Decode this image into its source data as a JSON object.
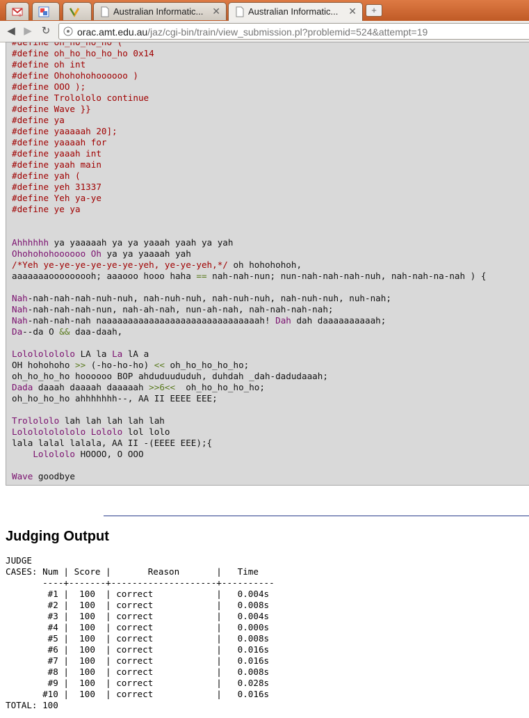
{
  "browser": {
    "tabs": [
      {
        "label": "",
        "icon": "gmail-icon"
      },
      {
        "label": "",
        "icon": "reader-icon"
      },
      {
        "label": "",
        "icon": "colorful-m-icon"
      },
      {
        "label": "Australian Informatic...",
        "icon": "page-icon"
      },
      {
        "label": "Australian Informatic...",
        "icon": "page-icon",
        "active": true
      }
    ],
    "gmail_count": "0",
    "url_host": "orac.amt.edu.au",
    "url_rest": "/jaz/cgi-bin/train/view_submission.pl?problemid=524&attempt=19"
  },
  "code_lines": [
    [
      [
        "pp",
        "#define oh_ho_ho_ho ( "
      ]
    ],
    [
      [
        "pp",
        "#define oh_ho_ho_ho_ho 0x14"
      ]
    ],
    [
      [
        "pp",
        "#define oh int"
      ]
    ],
    [
      [
        "pp",
        "#define Ohohohohoooooo )"
      ]
    ],
    [
      [
        "pp",
        "#define OOO );"
      ]
    ],
    [
      [
        "pp",
        "#define Trolololo continue"
      ]
    ],
    [
      [
        "pp",
        "#define Wave }}"
      ]
    ],
    [
      [
        "pp",
        "#define ya"
      ]
    ],
    [
      [
        "pp",
        "#define yaaaaah 20];"
      ]
    ],
    [
      [
        "pp",
        "#define yaaaah for"
      ]
    ],
    [
      [
        "pp",
        "#define yaaah int"
      ]
    ],
    [
      [
        "pp",
        "#define yaah main"
      ]
    ],
    [
      [
        "pp",
        "#define yah ("
      ]
    ],
    [
      [
        "pp",
        "#define yeh 31337"
      ]
    ],
    [
      [
        "pp",
        "#define Yeh ya-ye"
      ]
    ],
    [
      [
        "pp",
        "#define ye ya"
      ]
    ],
    [],
    [],
    [
      [
        "id",
        "Ahhhhhh"
      ],
      [
        "t",
        " ya yaaaaah ya ya yaaah yaah ya yah"
      ]
    ],
    [
      [
        "id",
        "Ohohohohoooooo"
      ],
      [
        "t",
        " "
      ],
      [
        "id",
        "Oh"
      ],
      [
        "t",
        " ya ya yaaaah yah"
      ]
    ],
    [
      [
        "cm",
        "/*Yeh ye-ye-ye-ye-ye-ye-yeh, ye-ye-yeh,*/"
      ],
      [
        "t",
        " oh hohohohoh,"
      ]
    ],
    [
      [
        "t",
        "aaaaaaaooooooooh; aaaooo hooo haha "
      ],
      [
        "op",
        "=="
      ],
      [
        "t",
        " nah-nah-nun; nun-nah-nah-nah-nuh, nah-nah-na-nah ) {"
      ]
    ],
    [],
    [
      [
        "id",
        "Nah"
      ],
      [
        "t",
        "-nah-nah-nah-nuh-nuh, nah-nuh-nuh, nah-nuh-nuh, nah-nuh-nuh, nuh-nah;"
      ]
    ],
    [
      [
        "id",
        "Nah"
      ],
      [
        "t",
        "-nah-nah-nah-nun, nah-ah-nah, nun-ah-nah, nah-nah-nah-nah;"
      ]
    ],
    [
      [
        "id",
        "Nah"
      ],
      [
        "t",
        "-nah-nah-nah naaaaaaaaaaaaaaaaaaaaaaaaaaaaaah! "
      ],
      [
        "id",
        "Dah"
      ],
      [
        "t",
        " dah daaaaaaaaaah;"
      ]
    ],
    [
      [
        "id",
        "Da"
      ],
      [
        "t",
        "--da O "
      ],
      [
        "op",
        "&&"
      ],
      [
        "t",
        " daa-daah,"
      ]
    ],
    [],
    [
      [
        "id",
        "Lolololololo"
      ],
      [
        "t",
        " LA la "
      ],
      [
        "id",
        "La"
      ],
      [
        "t",
        " lA a"
      ]
    ],
    [
      [
        "t",
        "OH hohohoho "
      ],
      [
        "op",
        ">>"
      ],
      [
        "t",
        " (-ho-ho-ho) "
      ],
      [
        "op",
        "<<"
      ],
      [
        "t",
        " oh_ho_ho_ho_ho;"
      ]
    ],
    [
      [
        "t",
        "oh_ho_ho_ho hoooooo BOP ahduduududuh, duhdah _dah-dadudaaah;"
      ]
    ],
    [
      [
        "id",
        "Dada"
      ],
      [
        "t",
        " daaah daaaah daaaaah "
      ],
      [
        "op",
        ">>6<<"
      ],
      [
        "t",
        "  oh_ho_ho_ho_ho;"
      ]
    ],
    [
      [
        "t",
        "oh_ho_ho_ho ahhhhhhh--, AA II EEEE EEE;"
      ]
    ],
    [],
    [
      [
        "id",
        "Trolololo"
      ],
      [
        "t",
        " lah lah lah lah lah"
      ]
    ],
    [
      [
        "id",
        "Lololololololo"
      ],
      [
        "t",
        " "
      ],
      [
        "id",
        "Lololo"
      ],
      [
        "t",
        " lol lolo"
      ]
    ],
    [
      [
        "t",
        "lala lalal lalala, AA II -(EEEE EEE);{"
      ]
    ],
    [
      [
        "t",
        "    "
      ],
      [
        "id",
        "Lolololo"
      ],
      [
        "t",
        " HOOOO, O OOO"
      ]
    ],
    [],
    [
      [
        "id",
        "Wave"
      ],
      [
        "t",
        " goodbye"
      ]
    ]
  ],
  "judging": {
    "heading": "Judging Output",
    "text": "JUDGE\nCASES: Num | Score |       Reason       |   Time\n       ----+-------+--------------------+----------\n        #1 |  100  | correct            |   0.004s\n        #2 |  100  | correct            |   0.008s\n        #3 |  100  | correct            |   0.004s\n        #4 |  100  | correct            |   0.000s\n        #5 |  100  | correct            |   0.008s\n        #6 |  100  | correct            |   0.016s\n        #7 |  100  | correct            |   0.016s\n        #8 |  100  | correct            |   0.008s\n        #9 |  100  | correct            |   0.028s\n       #10 |  100  | correct            |   0.016s\nTOTAL: 100"
  }
}
